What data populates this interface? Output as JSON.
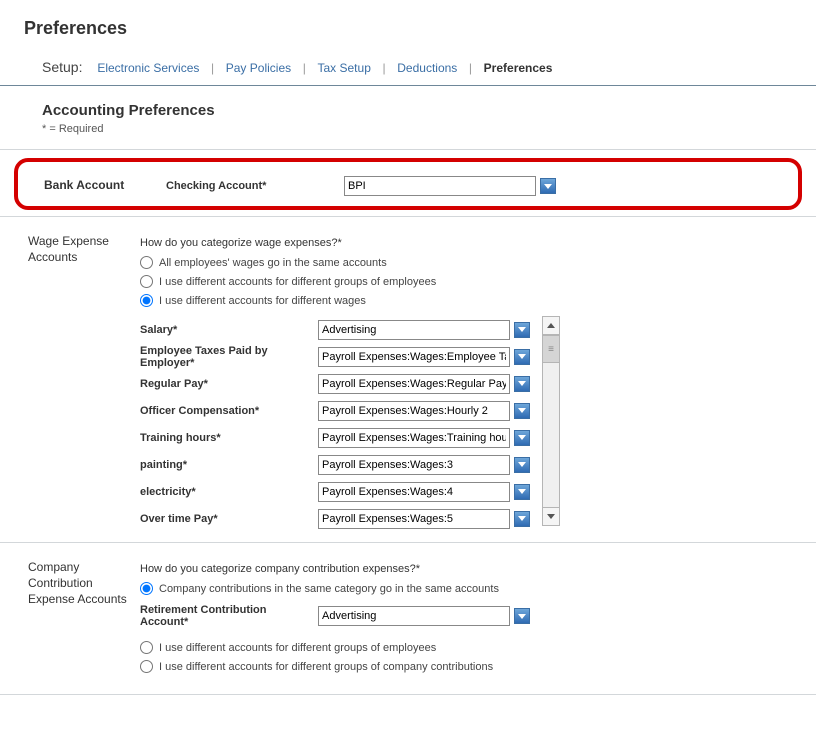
{
  "page_title": "Preferences",
  "setup": {
    "label": "Setup:",
    "links": [
      "Electronic Services",
      "Pay Policies",
      "Tax Setup",
      "Deductions"
    ],
    "current": "Preferences"
  },
  "section_title": "Accounting Preferences",
  "required_note": "* = Required",
  "bank_account": {
    "heading": "Bank Account",
    "field_label": "Checking Account*",
    "value": "BPI"
  },
  "wage_expense": {
    "heading": "Wage Expense Accounts",
    "question": "How do you categorize wage expenses?*",
    "options": {
      "same": "All employees' wages go in the same accounts",
      "groups": "I use different accounts for different groups of employees",
      "wages": "I use different accounts for different wages"
    },
    "selected": "wages",
    "fields": [
      {
        "label": "Salary*",
        "value": "Advertising"
      },
      {
        "label": "Employee Taxes Paid by Employer*",
        "value": "Payroll Expenses:Wages:Employee Taxe"
      },
      {
        "label": "Regular Pay*",
        "value": "Payroll Expenses:Wages:Regular Pay"
      },
      {
        "label": "Officer Compensation*",
        "value": "Payroll Expenses:Wages:Hourly 2"
      },
      {
        "label": "Training hours*",
        "value": "Payroll Expenses:Wages:Training hours"
      },
      {
        "label": "painting*",
        "value": "Payroll Expenses:Wages:3"
      },
      {
        "label": "electricity*",
        "value": "Payroll Expenses:Wages:4"
      },
      {
        "label": "Over time Pay*",
        "value": "Payroll Expenses:Wages:5"
      }
    ]
  },
  "company_contribution": {
    "heading": "Company Contribution Expense Accounts",
    "question": "How do you categorize company contribution expenses?*",
    "options": {
      "same": "Company contributions in the same category go in the same accounts",
      "groups": "I use different accounts for different groups of employees",
      "contribs": "I use different accounts for different groups of company contributions"
    },
    "selected": "same",
    "retirement_label": "Retirement Contribution Account*",
    "retirement_value": "Advertising"
  }
}
